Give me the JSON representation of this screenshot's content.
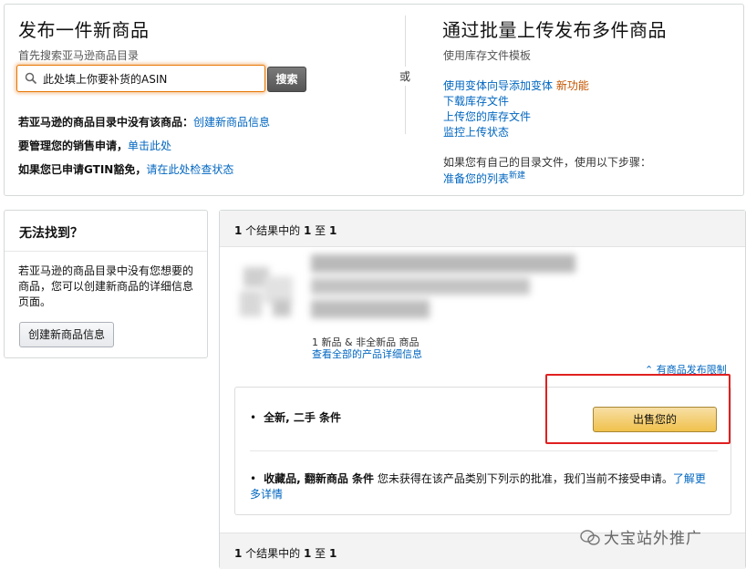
{
  "publish_single": {
    "title": "发布一件新商品",
    "subtitle": "首先搜索亚马逊商品目录",
    "search_value": "此处填上你要补货的ASIN",
    "search_button": "搜索",
    "line1_text": "若亚马逊的商品目录中没有该商品：",
    "line1_link": "创建新商品信息",
    "line2_text": "要管理您的销售申请，",
    "line2_link": "单击此处",
    "line3_text": "如果您已申请GTIN豁免，",
    "line3_link": "请在此处检查状态"
  },
  "or_label": "或",
  "publish_bulk": {
    "title": "通过批量上传发布多件商品",
    "subtitle": "使用库存文件模板",
    "link1": "使用变体向导添加变体",
    "link1_badge": "新功能",
    "link2": "下载库存文件",
    "link3": "上传您的库存文件",
    "link4": "监控上传状态",
    "own_template_text": "如果您有自己的目录文件，使用以下步骤：",
    "prepare_link": "准备您的列表",
    "prepare_badge": "新建"
  },
  "cant_find": {
    "title": "无法找到？",
    "body": "若亚马逊的商品目录中没有您想要的商品，您可以创建新商品的详细信息页面。",
    "button": "创建新商品信息"
  },
  "results": {
    "count_prefix": "1",
    "count_mid": " 个结果中的 ",
    "count_from": "1",
    "count_to_word": " 至 ",
    "count_to": "1",
    "offers_text": "1 新品 & 非全新品 商品",
    "details_link": "查看全部的产品详细信息",
    "restriction_link": "有商品发布限制",
    "condition1_label": "全新, 二手 条件",
    "sell_button": "出售您的",
    "condition2_bold": "收藏品, 翻新商品 条件",
    "condition2_text": " 您未获得在该产品类别下列示的批准，我们当前不接受申请。",
    "learn_more": "了解更多详情"
  },
  "watermark": "大宝站外推广",
  "colors": {
    "link": "#0066c0",
    "sell_button": "#f0c14b",
    "highlight_box": "#e02020",
    "new_badge": "#c45500"
  }
}
